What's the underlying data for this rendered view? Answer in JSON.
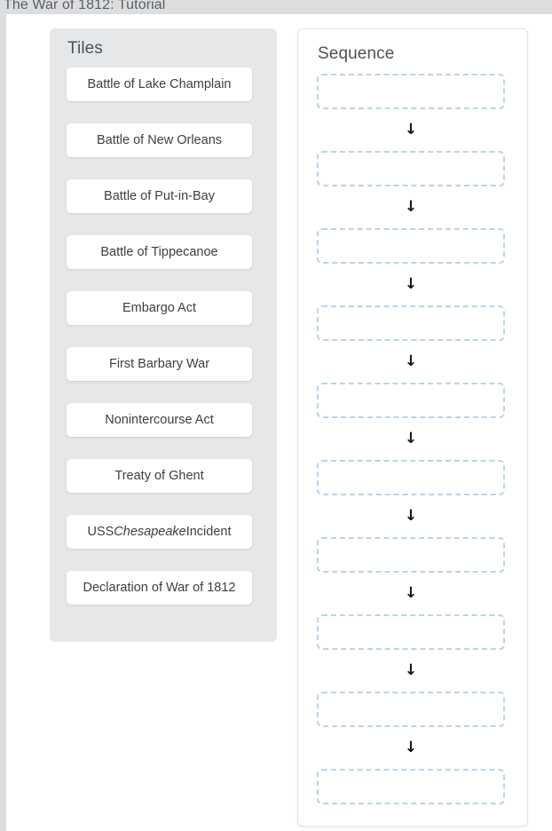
{
  "window": {
    "title": "The War of 1812: Tutorial"
  },
  "tiles_panel": {
    "heading": "Tiles",
    "items": [
      {
        "label": "Battle of Lake Champlain",
        "italic_part": ""
      },
      {
        "label": "Battle of New Orleans",
        "italic_part": ""
      },
      {
        "label": "Battle of Put-in-Bay",
        "italic_part": ""
      },
      {
        "label": "Battle of Tippecanoe",
        "italic_part": ""
      },
      {
        "label": "Embargo Act",
        "italic_part": ""
      },
      {
        "label": "First Barbary War",
        "italic_part": ""
      },
      {
        "label": "Nonintercourse Act",
        "italic_part": ""
      },
      {
        "label": "Treaty of Ghent",
        "italic_part": ""
      },
      {
        "label": "USS Chesapeake Incident",
        "italic_part": "Chesapeake"
      },
      {
        "label": "Declaration of War of 1812",
        "italic_part": ""
      }
    ]
  },
  "sequence_panel": {
    "heading": "Sequence",
    "slot_count": 10,
    "slots": [
      {
        "value": ""
      },
      {
        "value": ""
      },
      {
        "value": ""
      },
      {
        "value": ""
      },
      {
        "value": ""
      },
      {
        "value": ""
      },
      {
        "value": ""
      },
      {
        "value": ""
      },
      {
        "value": ""
      },
      {
        "value": ""
      }
    ],
    "arrow_glyph": "↓",
    "arrow_count": 9
  },
  "colors": {
    "chrome": "#dcdddf",
    "page": "#ffffff",
    "tiles_panel_bg": "#e6e7e8",
    "tile_bg": "#ffffff",
    "dropzone_border": "#b9d5e4",
    "heading_text": "#4d5256",
    "tile_text": "#3b4044",
    "title_text": "#5a5f63"
  }
}
